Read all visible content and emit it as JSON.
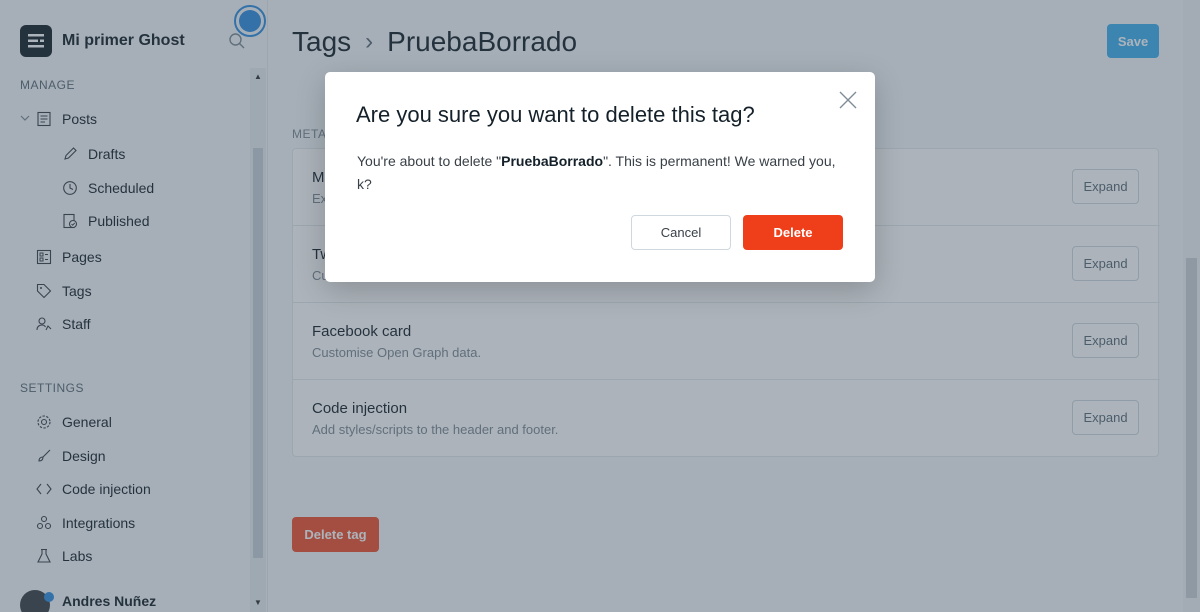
{
  "sidebar": {
    "brand_name": "Mi primer Ghost",
    "manage_label": "MANAGE",
    "settings_label": "SETTINGS",
    "manage_items": [
      {
        "label": "Posts",
        "icon": "posts-icon"
      },
      {
        "label": "Drafts",
        "icon": "pencil-icon"
      },
      {
        "label": "Scheduled",
        "icon": "clock-icon"
      },
      {
        "label": "Published",
        "icon": "published-icon"
      },
      {
        "label": "Pages",
        "icon": "pages-icon"
      },
      {
        "label": "Tags",
        "icon": "tag-icon"
      },
      {
        "label": "Staff",
        "icon": "staff-icon"
      }
    ],
    "settings_items": [
      {
        "label": "General",
        "icon": "gear-icon"
      },
      {
        "label": "Design",
        "icon": "brush-icon"
      },
      {
        "label": "Code injection",
        "icon": "code-icon"
      },
      {
        "label": "Integrations",
        "icon": "integrations-icon"
      },
      {
        "label": "Labs",
        "icon": "flask-icon"
      }
    ],
    "user_name": "Andres Nuñez"
  },
  "header": {
    "crumb_parent": "Tags",
    "crumb_current": "PruebaBorrado",
    "save_label": "Save"
  },
  "meta_label": "META",
  "meta_rows": [
    {
      "title": "M",
      "desc": "Ex",
      "expand": "Expand"
    },
    {
      "title": "Tw",
      "desc": "Cu",
      "expand": "Expand"
    },
    {
      "title": "Facebook card",
      "desc": "Customise Open Graph data.",
      "expand": "Expand"
    },
    {
      "title": "Code injection",
      "desc": "Add styles/scripts to the header and footer.",
      "expand": "Expand"
    }
  ],
  "delete_tag_label": "Delete tag",
  "modal": {
    "title": "Are you sure you want to delete this tag?",
    "body_prefix": "You're about to delete \"",
    "tag_name": "PruebaBorrado",
    "body_suffix": "\". This is permanent! We warned you, k?",
    "cancel_label": "Cancel",
    "delete_label": "Delete"
  },
  "colors": {
    "accent_blue": "#3eb0ef",
    "danger_red": "#ef3f1a",
    "overlay": "rgba(58,75,90,0.42)"
  }
}
